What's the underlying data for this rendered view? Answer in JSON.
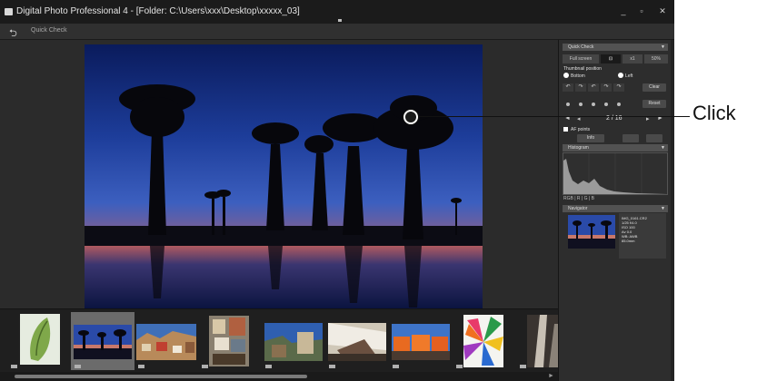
{
  "window": {
    "title": "Digital Photo Professional 4 - [Folder: C:\\Users\\xxx\\Desktop\\xxxxx_03]",
    "controls": {
      "minimize": "_",
      "maximize": "▫",
      "close": "✕"
    }
  },
  "toolbar": {
    "back_icon": "back-arrow-icon",
    "quick_check_label": "Quick Check"
  },
  "panel": {
    "quick_check_header": "Quick Check",
    "view_modes": [
      "Full screen",
      "Fit",
      "x1",
      "50%"
    ],
    "thumbnail_position_label": "Thumbnail position",
    "position_options": [
      "Bottom",
      "Left"
    ],
    "rotate_buttons": [
      "↶",
      "↷",
      "↶",
      "↷",
      "↷"
    ],
    "clear_label": "Clear",
    "reset_label": "Reset",
    "page_counter": "2 / 16",
    "af_points_label": "AF points",
    "info_button_label": "Info",
    "histogram_header": "Histogram",
    "histogram_readout": "RGB  |  R  |  G  |  B",
    "navigator_header": "Navigator",
    "info_lines": [
      "IMG_0161.CR2",
      "1/25 f/4.0",
      "ISO 100",
      "Av 0.0",
      "WB: AWB",
      "85.0mm"
    ]
  },
  "annotation": {
    "click_label": "Click"
  },
  "colors": {
    "accent_white": "#ffffff",
    "app_bg": "#2b2b2b",
    "panel_bg": "#2d2d2d"
  }
}
